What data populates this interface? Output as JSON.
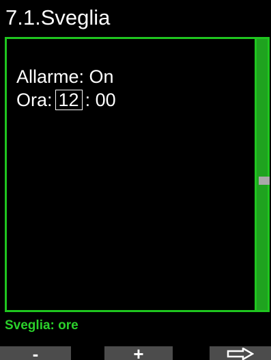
{
  "screen": {
    "title": "7.1.Sveglia",
    "alarm_label": "Allarme:",
    "alarm_value": "On",
    "time_label": "Ora:",
    "hour_value": "12",
    "separator": ":",
    "minute_value": "00",
    "status": "Sveglia: ore"
  },
  "softkeys": {
    "minus": "-",
    "plus": "+",
    "next_icon": "right-arrow-icon"
  },
  "colors": {
    "accent": "#1fc61f",
    "status_text": "#2bd12b",
    "softkey_bg": "#4c4c4c",
    "background": "#000000"
  }
}
